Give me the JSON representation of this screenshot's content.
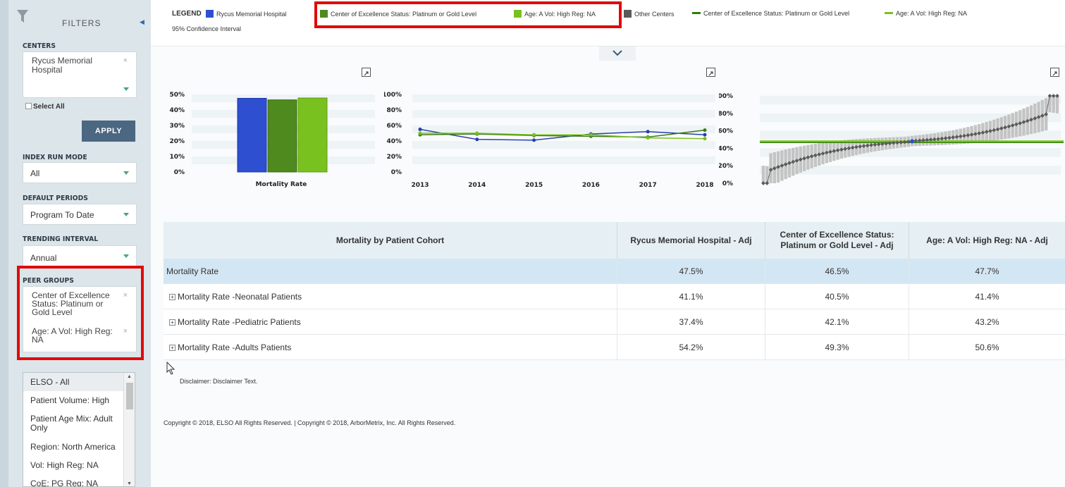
{
  "sidebar": {
    "title": "FILTERS",
    "centers": {
      "label": "CENTERS",
      "selected": "Rycus Memorial Hospital",
      "select_all": "Select All"
    },
    "apply_label": "APPLY",
    "index_run_mode": {
      "label": "INDEX RUN MODE",
      "value": "All"
    },
    "default_periods": {
      "label": "DEFAULT PERIODS",
      "value": "Program To Date"
    },
    "trending_interval": {
      "label": "TRENDING INTERVAL",
      "value": "Annual"
    },
    "peer_groups": {
      "label": "PEER GROUPS",
      "selected": [
        "Center of Excellence Status: Platinum or Gold Level",
        "Age: A Vol: High Reg: NA"
      ]
    },
    "peer_options": [
      "ELSO - All",
      "Patient Volume: High",
      "Patient Age Mix: Adult Only",
      "Region: North America",
      "Vol: High Reg: NA",
      "CoE: PG Reg: NA"
    ]
  },
  "legend": {
    "label": "LEGEND",
    "items": [
      {
        "text": "Rycus Memorial Hospital",
        "kind": "swatch",
        "color": "#2f4fd1"
      },
      {
        "text": "Center of Excellence Status: Platinum or Gold Level",
        "kind": "swatch",
        "color": "#4f8a1e"
      },
      {
        "text": "Age: A Vol: High Reg: NA",
        "kind": "swatch",
        "color": "#79c11f"
      },
      {
        "text": "Other Centers",
        "kind": "swatch",
        "color": "#5a5a5a"
      },
      {
        "text": "Center of Excellence Status: Platinum or Gold Level",
        "kind": "line",
        "color": "#2f7d12"
      },
      {
        "text": "Age: A Vol: High Reg: NA",
        "kind": "line",
        "color": "#79c11f"
      }
    ],
    "ci": "95% Confidence Interval"
  },
  "chart_data": [
    {
      "type": "bar",
      "categories": [
        "Mortality Rate"
      ],
      "series": [
        {
          "name": "Rycus Memorial Hospital",
          "values": [
            47.5
          ]
        },
        {
          "name": "Center of Excellence Status: Platinum or Gold Level",
          "values": [
            46.5
          ]
        },
        {
          "name": "Age: A Vol: High Reg: NA",
          "values": [
            47.7
          ]
        }
      ],
      "yticks": [
        "0%",
        "10%",
        "20%",
        "30%",
        "40%",
        "50%"
      ],
      "ylim": [
        0,
        50
      ]
    },
    {
      "type": "line",
      "x": [
        "2013",
        "2014",
        "2015",
        "2016",
        "2017",
        "2018"
      ],
      "series": [
        {
          "name": "Rycus Memorial Hospital",
          "values": [
            55,
            42,
            41,
            49,
            52,
            48
          ]
        },
        {
          "name": "Center of Excellence Status: Platinum or Gold Level",
          "values": [
            48,
            49,
            47,
            46,
            45,
            54
          ]
        },
        {
          "name": "Age: A Vol: High Reg: NA",
          "values": [
            50,
            50,
            48,
            48,
            44,
            43
          ]
        }
      ],
      "yticks": [
        "0%",
        "20%",
        "40%",
        "60%",
        "80%",
        "100%"
      ],
      "ylim": [
        0,
        100
      ]
    },
    {
      "type": "scatter",
      "yticks": [
        "0%",
        "20%",
        "40%",
        "60%",
        "80%",
        "100%"
      ],
      "ylim": [
        0,
        100
      ],
      "reference_lines": [
        47,
        48
      ]
    }
  ],
  "table": {
    "headers": [
      "Mortality by Patient Cohort",
      "Rycus Memorial Hospital - Adj",
      "Center of Excellence Status: Platinum or Gold Level - Adj",
      "Age: A Vol: High Reg: NA - Adj"
    ],
    "rows": [
      {
        "name": "Mortality Rate",
        "expandable": false,
        "values": [
          "47.5%",
          "46.5%",
          "47.7%"
        ]
      },
      {
        "name": "Mortality Rate -Neonatal Patients",
        "expandable": true,
        "values": [
          "41.1%",
          "40.5%",
          "41.4%"
        ]
      },
      {
        "name": "Mortality Rate -Pediatric Patients",
        "expandable": true,
        "values": [
          "37.4%",
          "42.1%",
          "43.2%"
        ]
      },
      {
        "name": "Mortality Rate -Adults Patients",
        "expandable": true,
        "values": [
          "54.2%",
          "49.3%",
          "50.6%"
        ]
      }
    ]
  },
  "footer": {
    "disclaimer": "Disclaimer: Disclaimer Text.",
    "copyright": "Copyright © 2018, ELSO All Rights Reserved. | Copyright © 2018, ArborMetrix, Inc. All Rights Reserved."
  }
}
